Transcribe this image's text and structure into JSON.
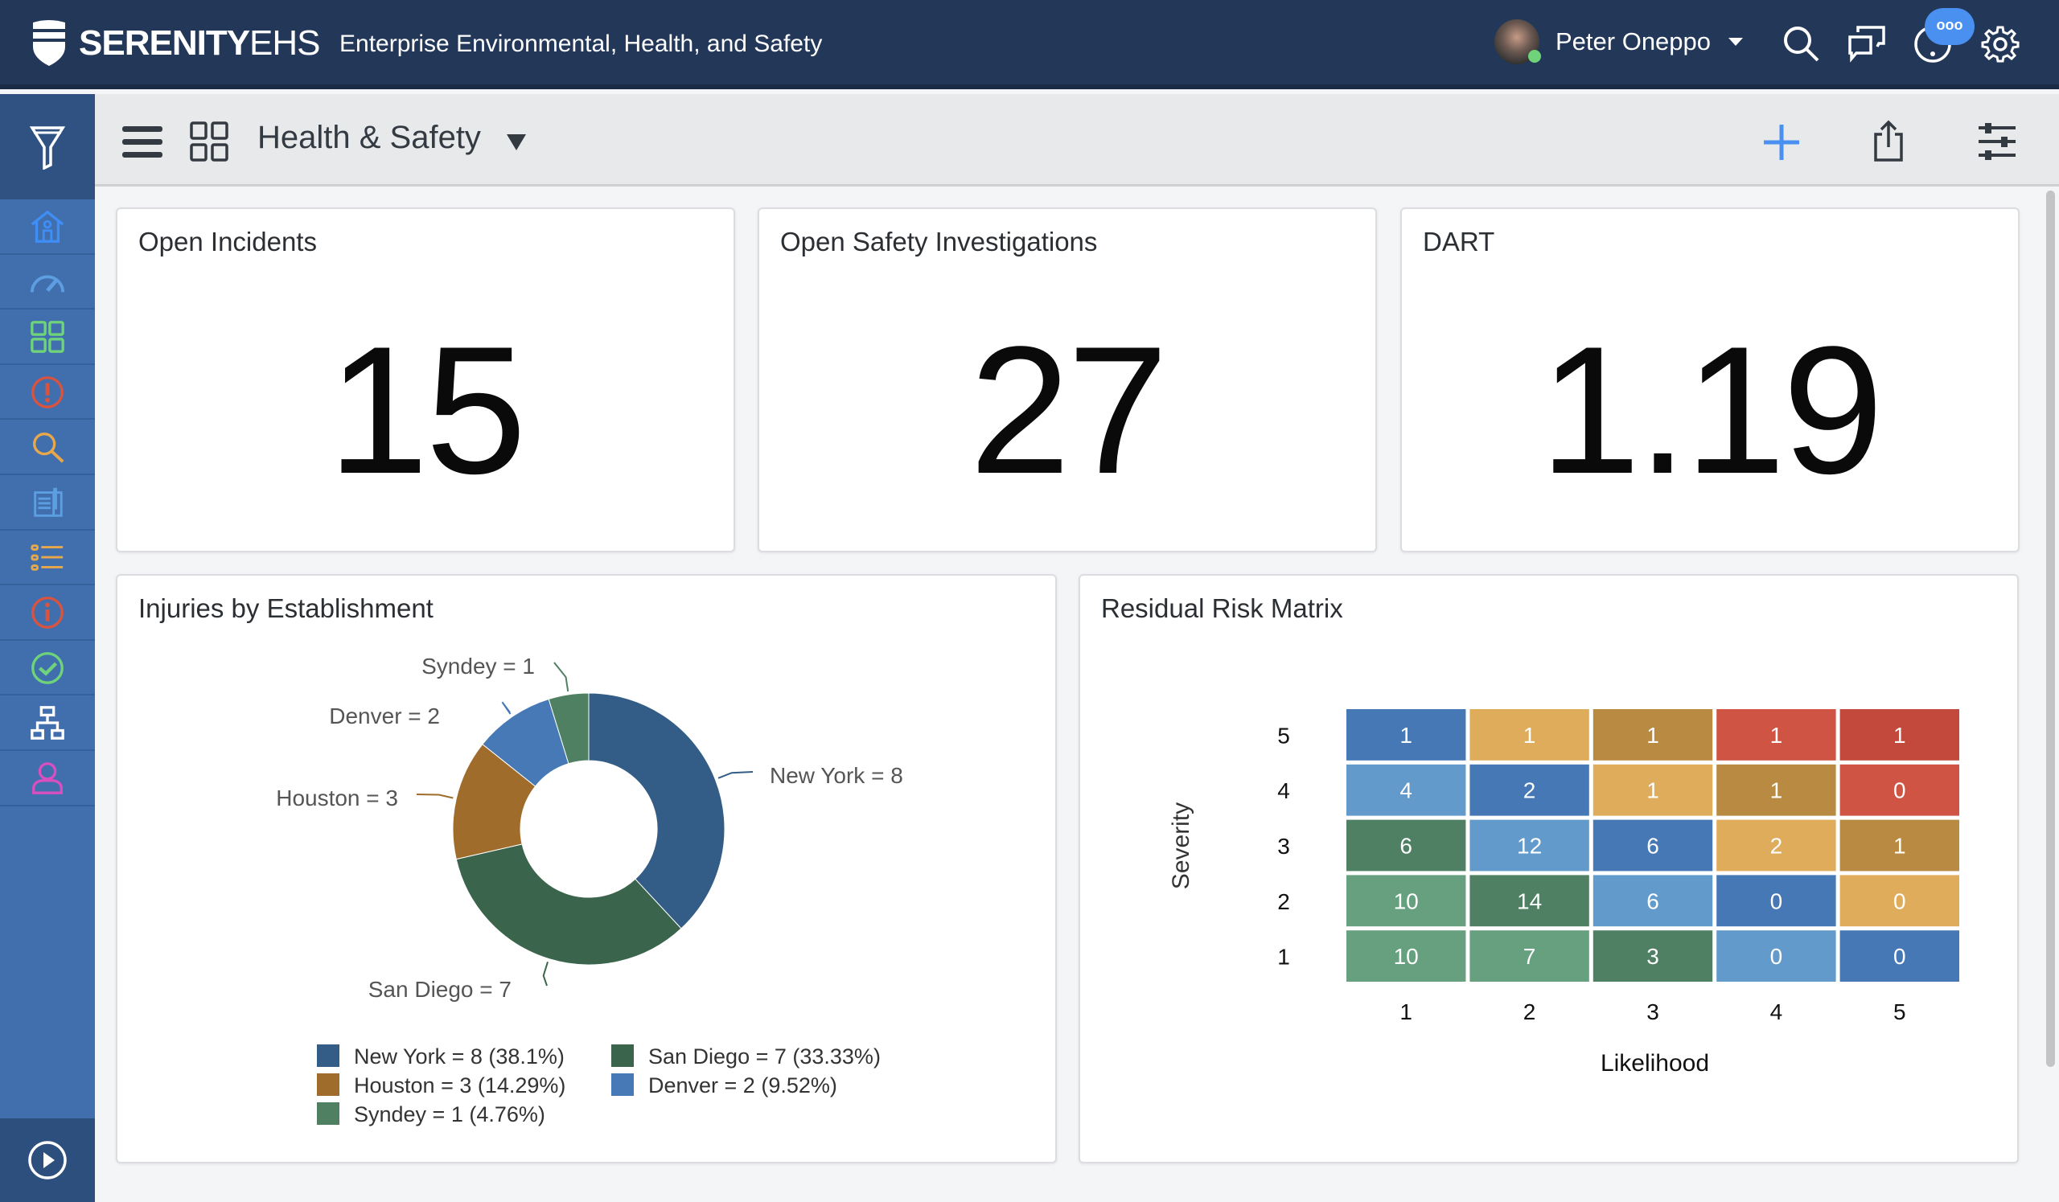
{
  "header": {
    "brand_bold": "SERENITY",
    "brand_light": "EHS",
    "tagline": "Enterprise Environmental, Health, and Safety",
    "user_name": "Peter Oneppo",
    "chat_badge": "ooo",
    "icons": [
      "search-icon",
      "chat-icon",
      "help-icon",
      "gear-icon"
    ]
  },
  "sidebar": {
    "items": [
      {
        "icon": "home-icon",
        "color": "#3f8ef5"
      },
      {
        "icon": "dashboard-gauge-icon",
        "color": "#5c9ee0"
      },
      {
        "icon": "grid-icon",
        "color": "#6fd37a"
      },
      {
        "icon": "alert-icon",
        "color": "#d9533f"
      },
      {
        "icon": "search-icon",
        "color": "#e8a84a"
      },
      {
        "icon": "document-icon",
        "color": "#5c9ee0"
      },
      {
        "icon": "checklist-icon",
        "color": "#e8a84a"
      },
      {
        "icon": "info-icon",
        "color": "#d9533f"
      },
      {
        "icon": "check-circle-icon",
        "color": "#6fd37a"
      },
      {
        "icon": "org-chart-icon",
        "color": "#ffffff"
      },
      {
        "icon": "user-icon",
        "color": "#d94fbf"
      }
    ]
  },
  "toolbar": {
    "title": "Health & Safety"
  },
  "kpis": [
    {
      "title": "Open Incidents",
      "value": "15"
    },
    {
      "title": "Open Safety Investigations",
      "value": "27"
    },
    {
      "title": "DART",
      "value": "1.19"
    }
  ],
  "chart_data": [
    {
      "type": "pie",
      "title": "Injuries by Establishment",
      "donut": true,
      "legend": "bottom",
      "slices": [
        {
          "name": "New York",
          "value": 8,
          "label": "New York = 8",
          "legend": "New York = 8 (38.1%)",
          "color": "#335d86"
        },
        {
          "name": "San Diego",
          "value": 7,
          "label": "San Diego = 7",
          "legend": "San Diego = 7 (33.33%)",
          "color": "#3a654c"
        },
        {
          "name": "Houston",
          "value": 3,
          "label": "Houston = 3",
          "legend": "Houston = 3 (14.29%)",
          "color": "#a06c2b"
        },
        {
          "name": "Denver",
          "value": 2,
          "label": "Denver = 2",
          "legend": "Denver = 2 (9.52%)",
          "color": "#4679b5"
        },
        {
          "name": "Syndey",
          "value": 1,
          "label": "Syndey = 1",
          "legend": "Syndey = 1 (4.76%)",
          "color": "#4e8061"
        }
      ]
    },
    {
      "type": "heatmap",
      "title": "Residual Risk Matrix",
      "xlabel": "Likelihood",
      "ylabel": "Severity",
      "x": [
        1,
        2,
        3,
        4,
        5
      ],
      "y": [
        5,
        4,
        3,
        2,
        1
      ],
      "values": [
        [
          1,
          1,
          1,
          1,
          1
        ],
        [
          4,
          2,
          1,
          1,
          0
        ],
        [
          6,
          12,
          6,
          2,
          1
        ],
        [
          10,
          14,
          6,
          0,
          0
        ],
        [
          10,
          7,
          3,
          0,
          0
        ]
      ],
      "colors": [
        [
          "#4578b4",
          "#dfac5b",
          "#b98a42",
          "#cf5444",
          "#c2493b"
        ],
        [
          "#629bcb",
          "#4578b4",
          "#dfac5b",
          "#b98a42",
          "#cf5444"
        ],
        [
          "#4f8063",
          "#629bcb",
          "#4578b4",
          "#dfac5b",
          "#b98a42"
        ],
        [
          "#66a07e",
          "#4f8063",
          "#629bcb",
          "#4578b4",
          "#dfac5b"
        ],
        [
          "#66a07e",
          "#66a07e",
          "#4f8063",
          "#629bcb",
          "#4578b4"
        ]
      ]
    }
  ]
}
